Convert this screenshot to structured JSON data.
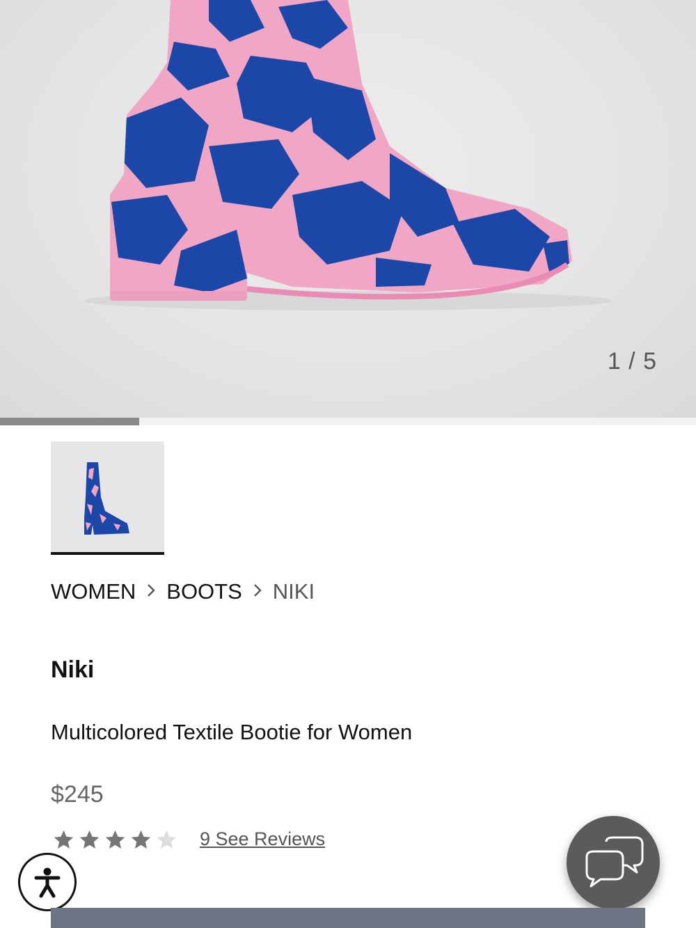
{
  "gallery": {
    "counter": "1 / 5",
    "current_index": 1,
    "total": 5,
    "progress_fraction": 0.2
  },
  "thumbnail": {
    "selected": true,
    "description_icon": "boot-thumbnail"
  },
  "breadcrumb": [
    {
      "label": "WOMEN"
    },
    {
      "label": "BOOTS"
    },
    {
      "label": "NIKI"
    }
  ],
  "product": {
    "name": "Niki",
    "description": "Multicolored Textile Bootie for Women",
    "price": "$245",
    "rating": 4,
    "rating_max": 5,
    "reviews_label": "9 See Reviews"
  },
  "icons": {
    "accessibility": "accessibility-icon",
    "chat": "chat-bubbles-icon",
    "chevron": "chevron-right-icon"
  },
  "colors": {
    "boot_pink": "#f0a6c4",
    "boot_blue": "#1c47a8",
    "star_filled": "#757575",
    "star_empty": "#dddddd"
  }
}
